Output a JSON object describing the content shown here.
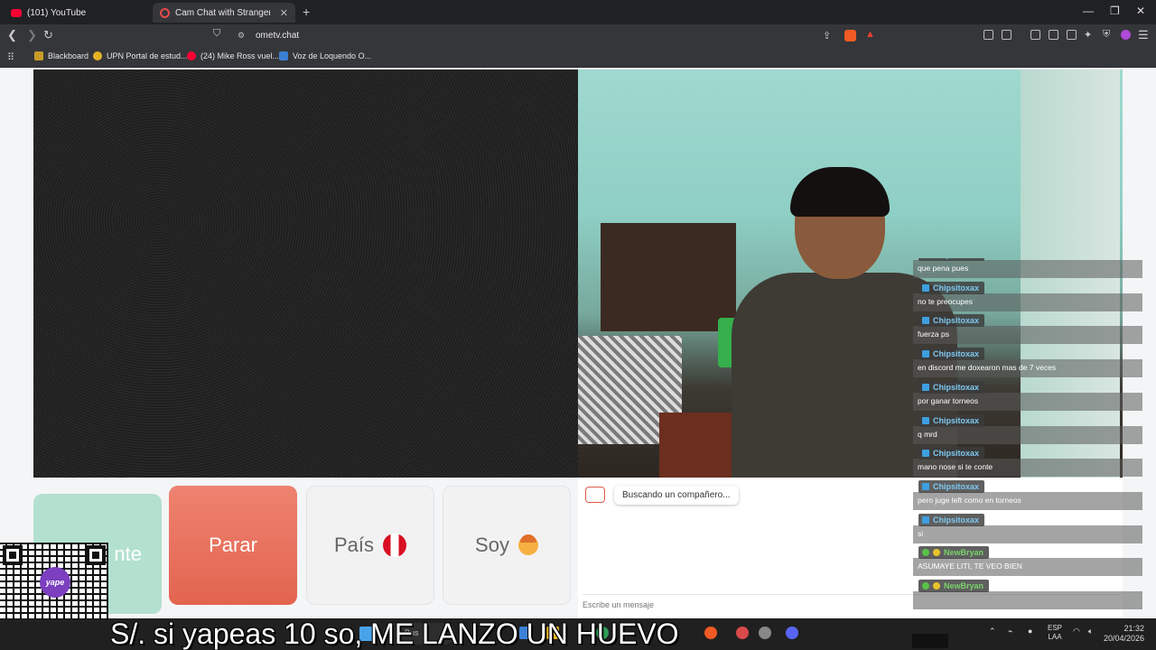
{
  "browser": {
    "tabs": [
      {
        "label": "(101) YouTube",
        "active": false
      },
      {
        "label": "Cam Chat with Strangers on O",
        "active": true
      }
    ],
    "url": "ometv.chat",
    "bookmarks": [
      {
        "label": "Blackboard",
        "icon": "blackboard-icon"
      },
      {
        "label": "UPN Portal de estud...",
        "icon": "upn-icon"
      },
      {
        "label": "(24) Mike Ross vuel...",
        "icon": "youtube-icon"
      },
      {
        "label": "Voz de Loquendo O...",
        "icon": "loquendo-icon"
      }
    ]
  },
  "controls": {
    "next_label": "nte",
    "stop_label": "Parar",
    "country_label": "País",
    "gender_label": "Soy"
  },
  "chat": {
    "status": "Buscando un compañero...",
    "input_placeholder": "Escribe un mensaje"
  },
  "overlay_chat": [
    {
      "user": "Chipsitoxax",
      "text": "que pena pues",
      "style": "blue"
    },
    {
      "user": "Chipsitoxax",
      "text": "no te preocupes",
      "style": "blue"
    },
    {
      "user": "Chipsitoxax",
      "text": "fuerza ps",
      "style": "blue"
    },
    {
      "user": "Chipsitoxax",
      "text": "en discord me doxearon mas de 7 veces",
      "style": "blue"
    },
    {
      "user": "Chipsitoxax",
      "text": "por ganar torneos",
      "style": "blue"
    },
    {
      "user": "Chipsitoxax",
      "text": "q mrd",
      "style": "blue"
    },
    {
      "user": "Chipsitoxax",
      "text": "mano nose si te conte",
      "style": "blue"
    },
    {
      "user": "Chipsitoxax",
      "text": "pero juge left como en torneos",
      "style": "blue"
    },
    {
      "user": "Chipsitoxax",
      "text": "si",
      "style": "blue"
    },
    {
      "user": "NewBryan",
      "text": "ASUMAYE LITI, TE VEO BIEN",
      "style": "green"
    },
    {
      "user": "NewBryan",
      "text": "",
      "style": "green"
    }
  ],
  "stream": {
    "ticker": "S/. si yapeas 10 so, ME LANZO UN HUEVO",
    "qr_label": "yape"
  },
  "taskbar": {
    "search_label": "Bus",
    "lang_top": "ESP",
    "lang_bottom": "LAA",
    "time": "21:32",
    "date": "20/04/2026"
  },
  "colors": {
    "stop_button": "#e2644f",
    "next_button": "#b3e0cf",
    "chat_user_blue": "#7ec8f0",
    "chat_user_green": "#7ad26b"
  }
}
